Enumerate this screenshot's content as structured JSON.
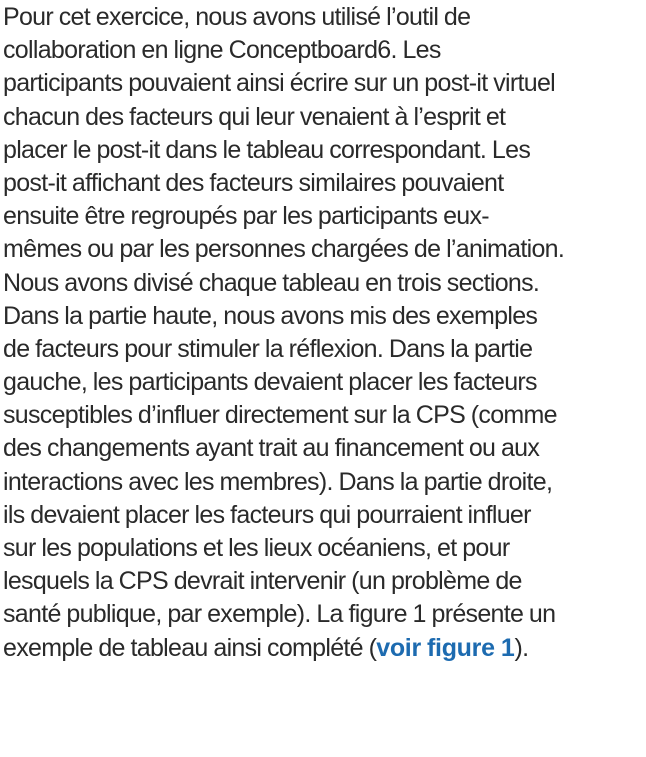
{
  "paragraph": {
    "lines": [
      "Pour cet exercice, nous avons utilisé l’outil de",
      "collaboration en ligne Conceptboard6. Les",
      "participants pouvaient ainsi écrire sur un post-it virtuel",
      "chacun des facteurs qui leur venaient à l’esprit et",
      "placer le post-it dans le tableau correspondant. Les",
      "post-it affichant des facteurs similaires pouvaient",
      "ensuite être regroupés par les participants eux-",
      "mêmes ou par les personnes chargées de l’animation.",
      "Nous avons divisé chaque tableau en trois sections.",
      "Dans la partie haute, nous avons mis des exemples",
      "de facteurs pour stimuler la réflexion. Dans la partie",
      "gauche, les participants devaient placer les facteurs",
      "susceptibles d’influer directement sur la CPS (comme",
      "des changements ayant trait au financement ou aux",
      "interactions avec les membres). Dans la partie droite,",
      "ils devaient placer les facteurs qui pourraient influer",
      "sur les populations et les lieux océaniens, et pour",
      "lesquels la CPS devrait intervenir (un problème de",
      "santé publique, par exemple). La figure 1 présente un"
    ],
    "last_line_before": "exemple de tableau ainsi complété  (",
    "last_line_link": "voir figure 1",
    "last_line_after": ")."
  },
  "colors": {
    "text": "#2a2a2a",
    "link": "#1d6bb0"
  }
}
